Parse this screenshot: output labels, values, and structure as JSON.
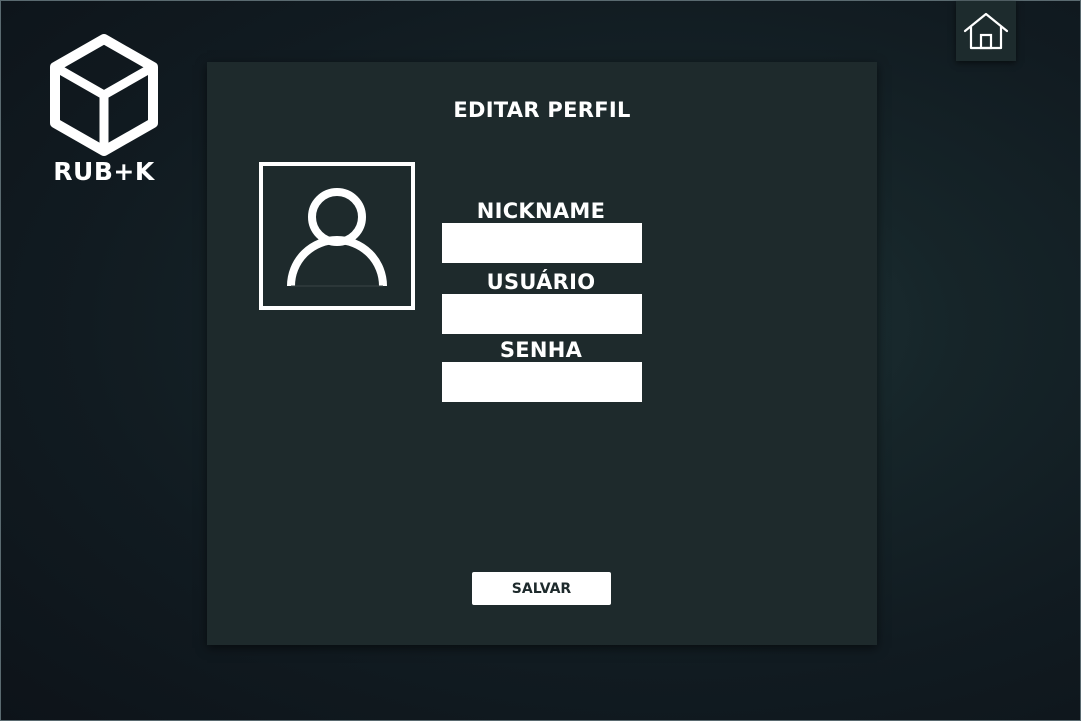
{
  "logo": {
    "text": "RUB+K",
    "icon": "cube-icon"
  },
  "header": {
    "home_icon": "home-icon"
  },
  "panel": {
    "title": "EDITAR PERFIL",
    "avatar_icon": "user-icon"
  },
  "form": {
    "nickname": {
      "label": "NICKNAME",
      "value": ""
    },
    "usuario": {
      "label": "USUÁRIO",
      "value": ""
    },
    "senha": {
      "label": "SENHA",
      "value": ""
    },
    "save_label": "SALVAR"
  },
  "colors": {
    "background": "#111b21",
    "panel": "#1e2a2c",
    "text": "#ffffff",
    "input_bg": "#ffffff"
  }
}
